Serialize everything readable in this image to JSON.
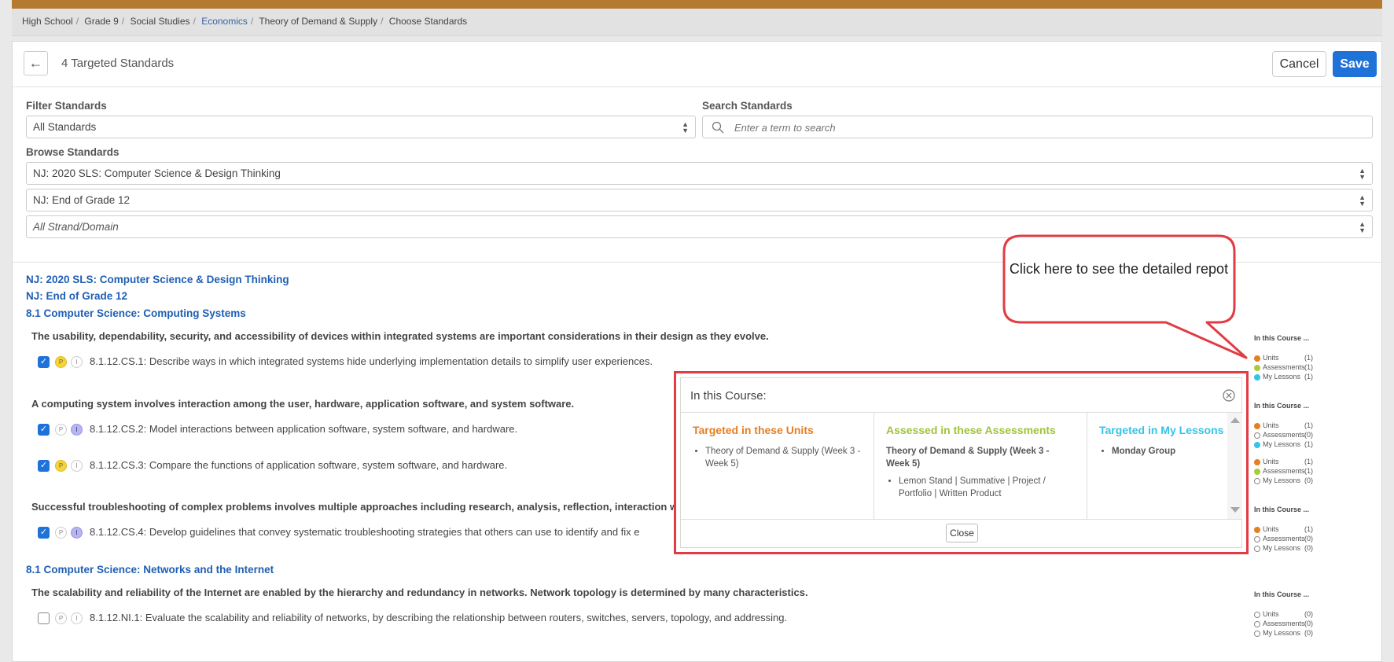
{
  "breadcrumb": [
    "High School",
    "Grade 9",
    "Social Studies",
    "Economics",
    "Theory of Demand & Supply",
    "Choose Standards"
  ],
  "header": {
    "title": "4 Targeted Standards",
    "back_icon": "←",
    "cancel_label": "Cancel",
    "save_label": "Save"
  },
  "filter": {
    "filter_label": "Filter Standards",
    "filter_value": "All Standards",
    "search_label": "Search Standards",
    "search_placeholder": "Enter a term to search",
    "browse_label": "Browse Standards",
    "browse_1": "NJ: 2020 SLS: Computer Science & Design Thinking",
    "browse_2": "NJ: End of Grade 12",
    "browse_3": "All Strand/Domain"
  },
  "nav": {
    "link_1": "NJ: 2020 SLS: Computer Science & Design Thinking",
    "link_2": "NJ: End of Grade 12",
    "link_3": "8.1 Computer Science: Computing Systems",
    "link_4": "8.1 Computer Science: Networks and the Internet"
  },
  "groups": {
    "g1": "The usability, dependability, security, and accessibility of devices within integrated systems are important considerations in their design as they evolve.",
    "g2": "A computing system involves interaction among the user, hardware, application software, and system software.",
    "g3": "Successful troubleshooting of complex problems involves multiple approaches including research, analysis, reflection, interaction wit",
    "g4": "The scalability and reliability of the Internet are enabled by the hierarchy and redundancy in networks. Network topology is determined by many characteristics."
  },
  "standards": [
    {
      "text": "8.1.12.CS.1: Describe ways in which integrated systems hide underlying implementation details to simplify user experiences.",
      "checked": true,
      "p": true,
      "i": false
    },
    {
      "text": "8.1.12.CS.2: Model interactions between application software, system software, and hardware.",
      "checked": true,
      "p": false,
      "i": true
    },
    {
      "text": "8.1.12.CS.3: Compare the functions of application software, system software, and hardware.",
      "checked": true,
      "p": true,
      "i": false
    },
    {
      "text": "8.1.12.CS.4: Develop guidelines that convey systematic troubleshooting strategies that others can use to identify and fix e",
      "checked": true,
      "p": false,
      "i": true
    },
    {
      "text": "8.1.12.NI.1: Evaluate the scalability and reliability of networks, by describing the relationship between routers, switches, servers, topology, and addressing.",
      "checked": false,
      "p": false,
      "i": false
    }
  ],
  "pill_labels": {
    "p": "P",
    "i": "I"
  },
  "course": {
    "heading": "In this Course ...",
    "units": "Units",
    "assessments": "Assessments",
    "lessons": "My Lessons",
    "blocks": [
      {
        "units": "(1)",
        "assessments": "(1)",
        "lessons": "(1)"
      },
      {
        "units": "(1)",
        "assessments": "(0)",
        "lessons": "(1)"
      },
      {
        "units": "(1)",
        "assessments": "(1)",
        "lessons": "(0)"
      },
      {
        "units": "(1)",
        "assessments": "(0)",
        "lessons": "(0)"
      },
      {
        "units": "(0)",
        "assessments": "(0)",
        "lessons": "(0)"
      }
    ]
  },
  "modal": {
    "title": "In this Course:",
    "units_head": "Targeted in these Units",
    "units_item": "Theory of Demand & Supply (Week 3 - Week 5)",
    "assess_head": "Assessed in these Assessments",
    "assess_group": "Theory of Demand & Supply (Week 3 - Week 5)",
    "assess_item": "Lemon Stand | Summative | Project / Portfolio | Written Product",
    "lessons_head": "Targeted in My Lessons",
    "lessons_item": "Monday Group",
    "close_label": "Close"
  },
  "callout": {
    "text": "Click here to see the detailed repot"
  },
  "colors": {
    "accent": "#1f72d8",
    "units": "#e67e22",
    "assessments": "#a6cc3a",
    "lessons": "#35c3e8",
    "highlight": "#e33b44"
  }
}
